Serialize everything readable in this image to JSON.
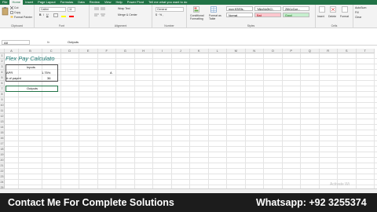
{
  "ribbon": {
    "tabs": [
      {
        "label": "File"
      },
      {
        "label": "Home"
      },
      {
        "label": "Insert"
      },
      {
        "label": "Page Layout"
      },
      {
        "label": "Formulas"
      },
      {
        "label": "Data"
      },
      {
        "label": "Review"
      },
      {
        "label": "View"
      },
      {
        "label": "Help"
      },
      {
        "label": "Power Pivot"
      },
      {
        "label": "Tell me what you want to do"
      }
    ],
    "clipboard": {
      "cut": "Cut",
      "copy": "Copy",
      "format_painter": "Format Painter",
      "label": "Clipboard"
    },
    "font": {
      "name": "Calibri",
      "size": "11",
      "label": "Font"
    },
    "alignment": {
      "wrap_text": "Wrap Text",
      "merge_center": "Merge & Center",
      "label": "Alignment"
    },
    "number": {
      "format": "General",
      "label": "Number"
    },
    "styles": {
      "conditional_formatting": "Conditional Formatting",
      "format_as_table": "Format as Table",
      "cells": [
        {
          "text": "Normal"
        },
        {
          "text": "Bad"
        },
        {
          "text": "Good"
        },
        {
          "text": "Normal 2"
        }
      ],
      "top_cells": [
        {
          "text": "mon.KSISfs.."
        },
        {
          "text": "YAbcNo0hCj.."
        },
        {
          "text": "Z6h1cCoe..."
        }
      ],
      "label": "Styles"
    },
    "cells_group": {
      "insert": "Insert",
      "delete": "Delete",
      "format": "Format",
      "label": "Cells"
    },
    "editing": {
      "autosum": "AutoSum",
      "fill": "Fill",
      "clear": "Clear",
      "label": "Editing"
    }
  },
  "formula_bar": {
    "name_box": "A8",
    "fx": "fx",
    "content": "Outputs"
  },
  "sheet": {
    "columns": [
      "A",
      "B",
      "C",
      "D",
      "E",
      "F",
      "G",
      "H",
      "I",
      "J",
      "K",
      "L",
      "M",
      "N",
      "O",
      "P",
      "Q",
      "R",
      "S",
      "T"
    ],
    "rows": [
      "1",
      "2",
      "3",
      "4",
      "5",
      "6",
      "7",
      "8",
      "9",
      "10",
      "11",
      "12",
      "13",
      "14",
      "15",
      "16",
      "17",
      "18",
      "19",
      "20",
      "21",
      "22",
      "23",
      "24",
      "25"
    ],
    "title": "Flex Pay Calculato",
    "inputs_header": "Inputs",
    "apr_label": "APR",
    "apr_value": "1.75%",
    "payments_label": "# of paymt",
    "payments_value": "36",
    "outputs_header": "Outputs",
    "stray": "A"
  },
  "watermark": "Activate Wi",
  "banner": {
    "left": "Contact Me For Complete Solutions",
    "right": "Whatsapp: +92 3255374"
  },
  "colors": {
    "excel_green": "#217346",
    "banner_bg": "#1c1c1c",
    "title_teal": "#1f7a74"
  }
}
